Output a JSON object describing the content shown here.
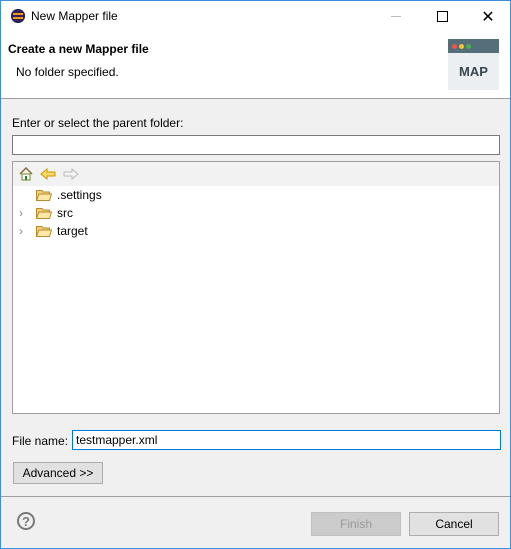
{
  "window": {
    "title": "New Mapper file",
    "controls": [
      "minimize",
      "maximize",
      "close"
    ]
  },
  "header": {
    "title": "Create a new Mapper file",
    "message": "No folder specified.",
    "banner_text": "MAP",
    "banner_colors": {
      "bar": "#546e7a",
      "dot1": "#ef5350",
      "dot2": "#fbc02d",
      "dot3": "#4caf50"
    }
  },
  "parent": {
    "label": "Enter or select the parent folder:",
    "value": "",
    "toolbar_icons": [
      "home-icon",
      "back-icon",
      "forward-icon"
    ],
    "tree": [
      {
        "label": ".settings",
        "expandable": false
      },
      {
        "label": "src",
        "expandable": true
      },
      {
        "label": "target",
        "expandable": true
      }
    ]
  },
  "file": {
    "label": "File name:",
    "value": "testmapper.xml"
  },
  "buttons": {
    "advanced": "Advanced >>",
    "finish": "Finish",
    "cancel": "Cancel",
    "help": "?"
  }
}
